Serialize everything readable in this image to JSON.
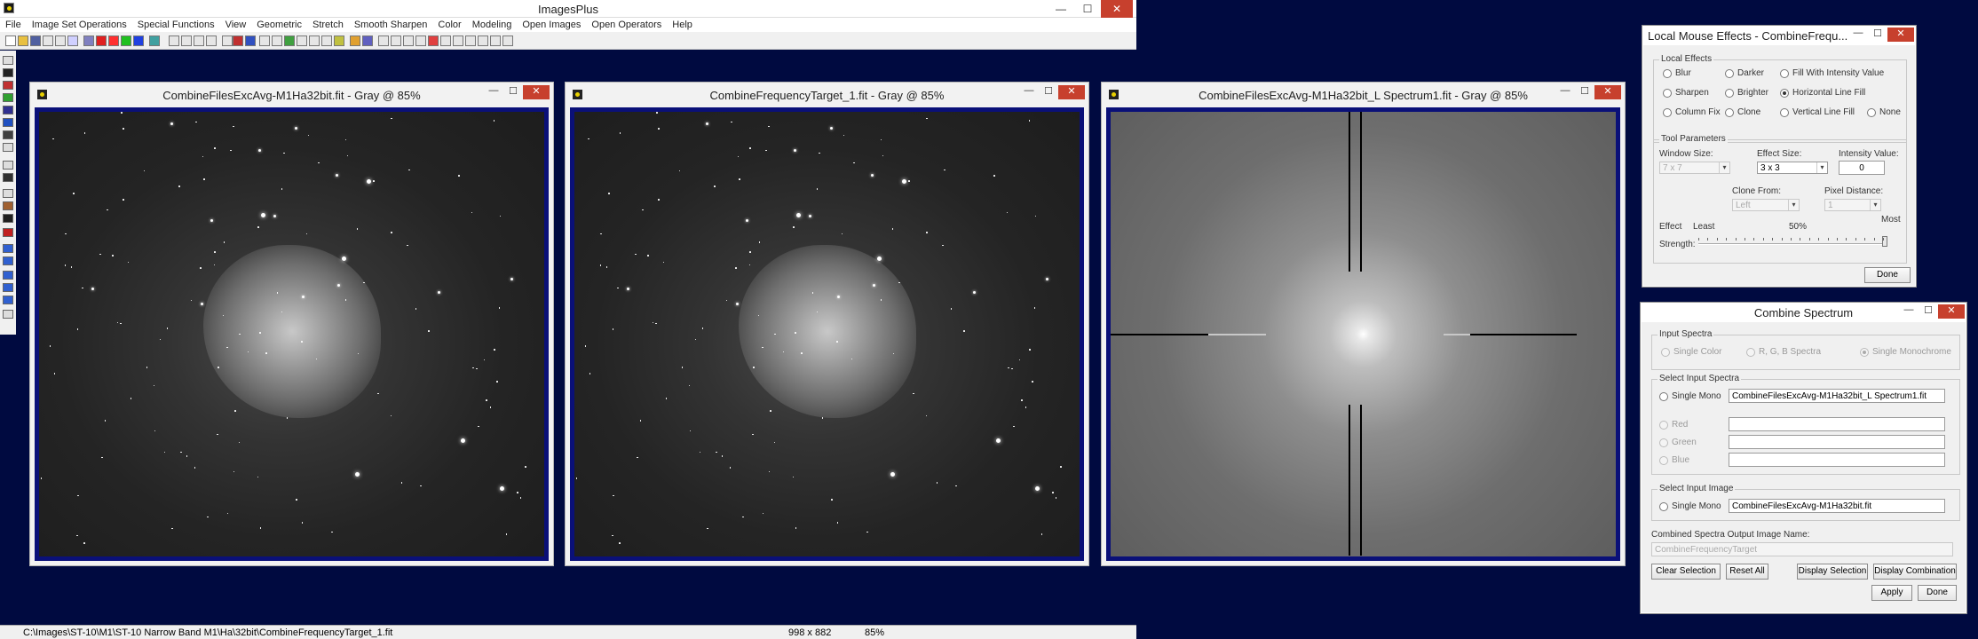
{
  "app": {
    "title": "ImagesPlus",
    "menu": [
      "File",
      "Image Set Operations",
      "Special Functions",
      "View",
      "Geometric",
      "Stretch",
      "Smooth Sharpen",
      "Color",
      "Modeling",
      "Open Images",
      "Open Operators",
      "Help"
    ],
    "window_controls": {
      "minimize": "—",
      "maximize": "☐",
      "close": "✕"
    }
  },
  "image_windows": [
    {
      "title": "CombineFilesExcAvg-M1Ha32bit.fit - Gray @ 85%",
      "content": "nebula-image"
    },
    {
      "title": "CombineFrequencyTarget_1.fit - Gray @ 85%",
      "content": "nebula-image"
    },
    {
      "title": "CombineFilesExcAvg-M1Ha32bit_L Spectrum1.fit - Gray @ 85%",
      "content": "frequency-spectrum"
    }
  ],
  "status_bar": {
    "path": "C:\\Images\\ST-10\\M1\\ST-10 Narrow Band M1\\Ha\\32bit\\CombineFrequencyTarget_1.fit",
    "dimensions": "998 x 882",
    "zoom": "85%"
  },
  "local_mouse_effects": {
    "title": "Local Mouse Effects - CombineFrequ...",
    "effects_group": "Local Effects",
    "effects": [
      {
        "label": "Blur",
        "selected": false
      },
      {
        "label": "Darker",
        "selected": false
      },
      {
        "label": "Fill With Intensity Value",
        "selected": false
      },
      {
        "label": "Sharpen",
        "selected": false
      },
      {
        "label": "Brighter",
        "selected": false
      },
      {
        "label": "Horizontal Line Fill",
        "selected": true
      },
      {
        "label": "Column Fix",
        "selected": false
      },
      {
        "label": "Clone",
        "selected": false
      },
      {
        "label": "Vertical Line Fill",
        "selected": false
      },
      {
        "label": "None",
        "selected": false
      }
    ],
    "params_group": "Tool Parameters",
    "window_size_label": "Window Size:",
    "window_size_value": "7 x 7",
    "effect_size_label": "Effect Size:",
    "effect_size_value": "3 x 3",
    "intensity_label": "Intensity Value:",
    "intensity_value": "0",
    "clone_from_label": "Clone From:",
    "clone_from_value": "Left",
    "pixel_distance_label": "Pixel Distance:",
    "pixel_distance_value": "1",
    "effect_label": "Effect",
    "least_label": "Least",
    "mid_label": "50%",
    "most_label": "Most",
    "strength_label": "Strength:",
    "strength_value": 1.0,
    "done_label": "Done"
  },
  "combine_spectrum": {
    "title": "Combine Spectrum",
    "input_spectra_group": "Input Spectra",
    "input_options": [
      {
        "label": "Single Color",
        "selected": false
      },
      {
        "label": "R, G, B Spectra",
        "selected": false
      },
      {
        "label": "Single Monochrome",
        "selected": true
      }
    ],
    "select_input_spectra_group": "Select Input Spectra",
    "single_mono_label": "Single Mono",
    "single_mono_value": "CombineFilesExcAvg-M1Ha32bit_L Spectrum1.fit",
    "red_label": "Red",
    "green_label": "Green",
    "blue_label": "Blue",
    "select_input_image_group": "Select Input Image",
    "image_single_mono_label": "Single Mono",
    "image_single_mono_value": "CombineFilesExcAvg-M1Ha32bit.fit",
    "output_label": "Combined Spectra Output Image Name:",
    "output_value": "CombineFrequencyTarget",
    "buttons": {
      "clear": "Clear Selection",
      "reset": "Reset All",
      "display_selection": "Display Selection",
      "display_combination": "Display Combination",
      "apply": "Apply",
      "done": "Done"
    }
  }
}
